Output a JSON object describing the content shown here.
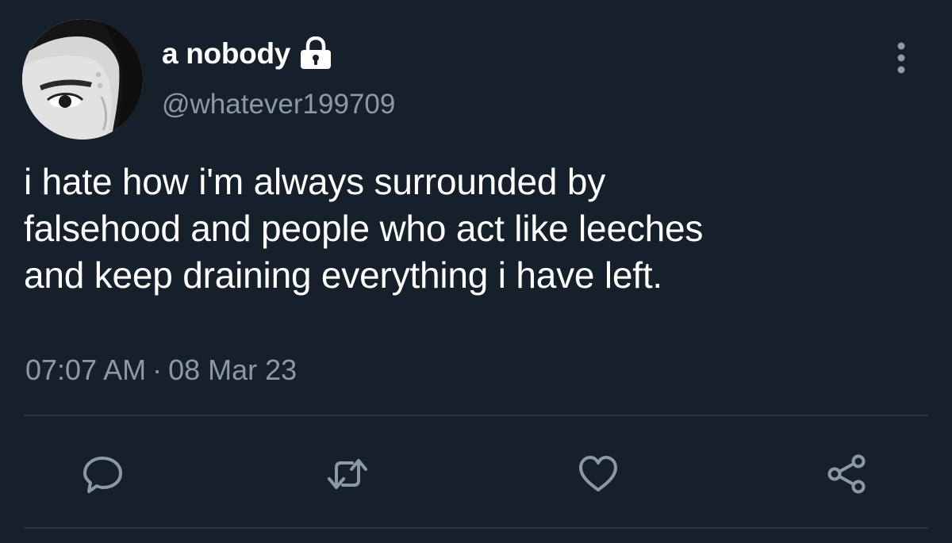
{
  "tweet": {
    "display_name": "a nobody",
    "handle": "@whatever199709",
    "text": "i hate how i'm always surrounded by\nfalsehood and people who act like leeches\nand keep draining everything i have left.",
    "time": "07:07 AM",
    "separator": "·",
    "date": "08 Mar 23"
  },
  "icons": {
    "header": [
      "avatar",
      "lock-icon",
      "more-icon"
    ],
    "actions": [
      "reply-icon",
      "retweet-icon",
      "like-icon",
      "share-icon"
    ]
  },
  "colors": {
    "background": "#16202b",
    "primary_text": "#ffffff",
    "secondary_text": "#8b98a5",
    "divider": "#2a3642"
  }
}
